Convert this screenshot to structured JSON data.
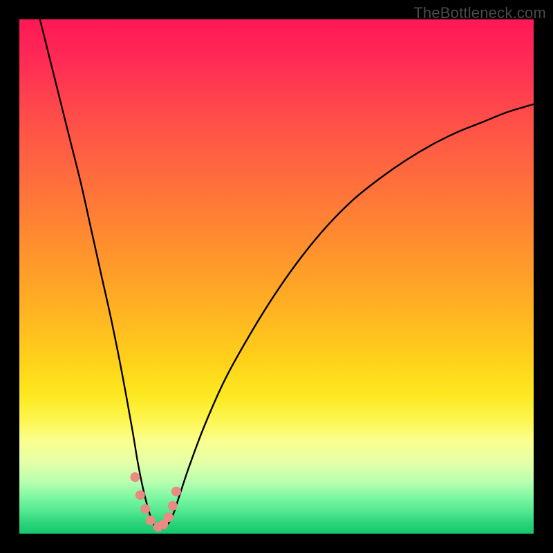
{
  "watermark": "TheBottleneck.com",
  "colors": {
    "frame": "#000000",
    "curve": "#000000",
    "marker": "#e98b82",
    "gradient_stops": [
      "#ff1755",
      "#ff2b55",
      "#ff4a4a",
      "#ff6a3e",
      "#ff8a30",
      "#ffab24",
      "#ffd01a",
      "#fde81f",
      "#fdf652",
      "#faff8e",
      "#e6ffa6",
      "#b8ffb0",
      "#7cf7a2",
      "#4de58e",
      "#2bd37a",
      "#16c96e"
    ]
  },
  "chart_data": {
    "type": "line",
    "title": "",
    "xlabel": "",
    "ylabel": "",
    "xlim": [
      0,
      100
    ],
    "ylim": [
      0,
      100
    ],
    "note": "Axes unlabeled in source image; x/y are normalized 0–100 plot-area units (origin bottom-left). Curve resembles a bottleneck V reaching ~0 near x≈26.",
    "series": [
      {
        "name": "bottleneck-curve",
        "x": [
          4,
          6,
          8,
          10,
          12,
          14,
          16,
          18,
          20,
          22,
          23,
          24,
          25,
          26,
          27,
          28,
          29,
          30,
          31,
          33,
          36,
          40,
          45,
          50,
          55,
          60,
          65,
          70,
          75,
          80,
          85,
          90,
          95,
          100
        ],
        "values": [
          100,
          92,
          84,
          76,
          68,
          59,
          50,
          41,
          31,
          20,
          14,
          9,
          5,
          2,
          1,
          1,
          2,
          4,
          7,
          13,
          21,
          30,
          39,
          47,
          54,
          60,
          65,
          69,
          72.5,
          75.5,
          78,
          80,
          82,
          83.5
        ]
      }
    ],
    "markers": {
      "name": "highlighted-points",
      "note": "Salmon dots clustered at the trough of the curve.",
      "x": [
        22.5,
        23.5,
        24.5,
        25.5,
        27.0,
        28.0,
        29.0,
        29.8,
        30.5
      ],
      "values": [
        11.0,
        7.5,
        4.8,
        2.6,
        1.3,
        1.8,
        3.2,
        5.4,
        8.2
      ]
    }
  }
}
